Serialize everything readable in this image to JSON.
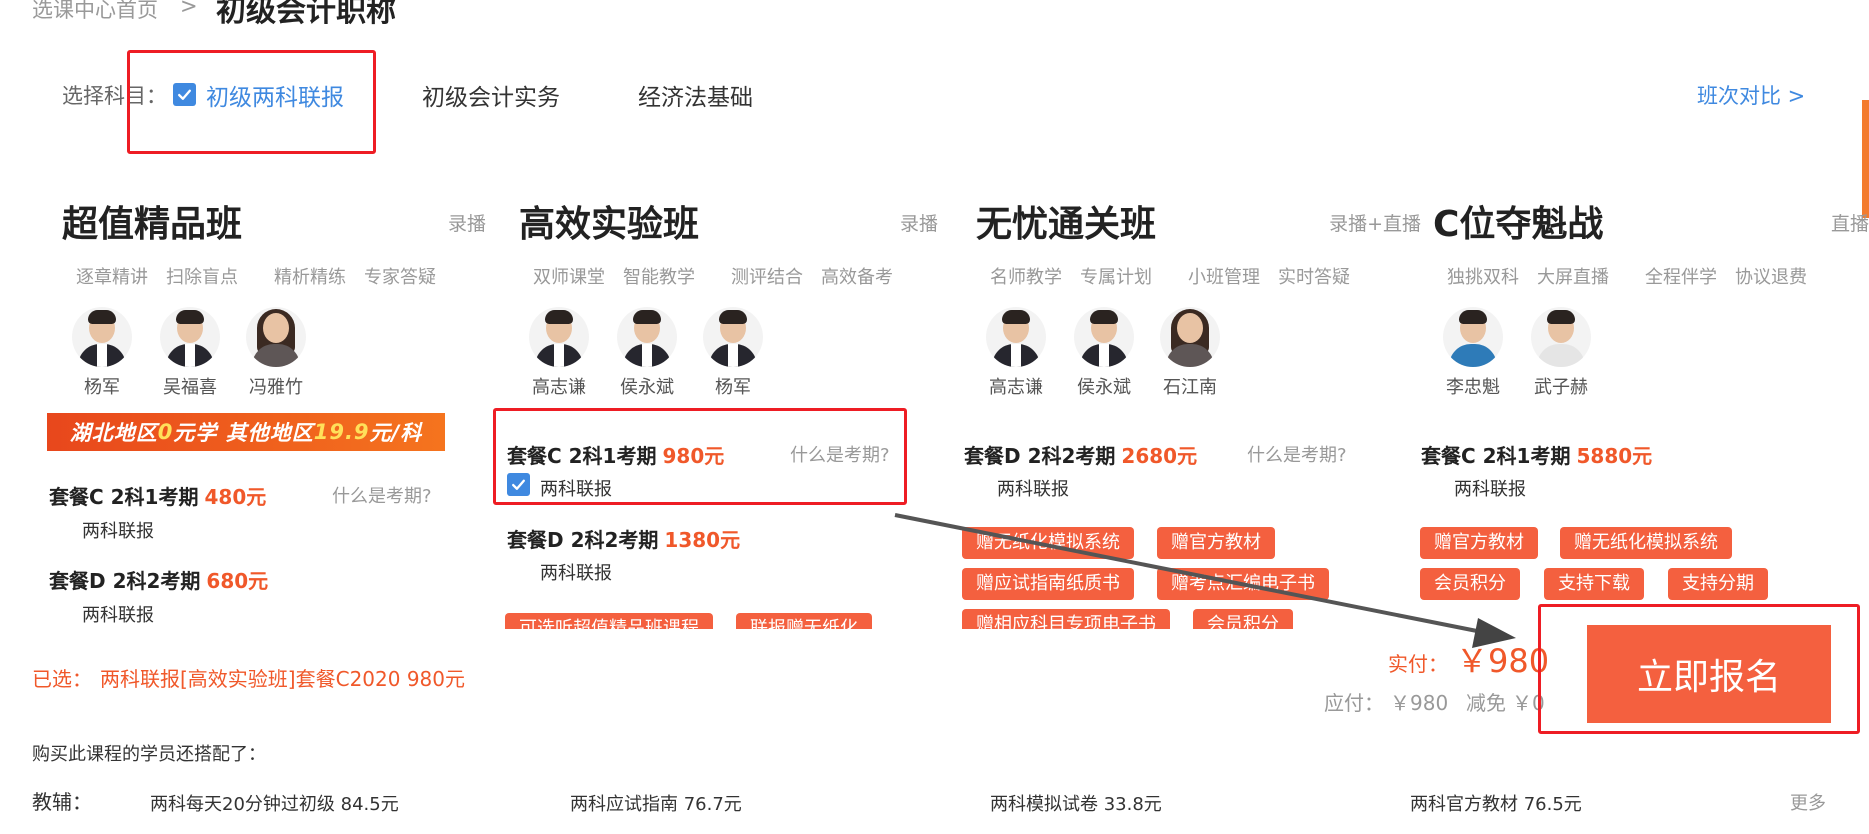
{
  "breadcrumb": {
    "home": "选课中心首页",
    "separator": ">",
    "current": "初级会计职称"
  },
  "subjects": {
    "label": "选择科目：",
    "items": [
      "初级两科联报",
      "初级会计实务",
      "经济法基础"
    ],
    "compare": "班次对比 >"
  },
  "columns": [
    {
      "title": "超值精品班",
      "mode": "录播",
      "features": [
        "逐章精讲",
        "扫除盲点",
        "精析精练",
        "专家答疑"
      ],
      "teachers": [
        "杨军",
        "吴福喜",
        "冯雅竹"
      ],
      "banner": {
        "part1": "湖北地区",
        "hl1": "0",
        "part2": "元学  其他地区",
        "hl2": "19.9",
        "part3": "元/科"
      },
      "packages": [
        {
          "name": "套餐C 2科1考期",
          "price": "480元",
          "question": "什么是考期?",
          "sub": "两科联报"
        },
        {
          "name": "套餐D 2科2考期",
          "price": "680元",
          "sub": "两科联报"
        }
      ]
    },
    {
      "title": "高效实验班",
      "mode": "录播",
      "features": [
        "双师课堂",
        "智能教学",
        "测评结合",
        "高效备考"
      ],
      "teachers": [
        "高志谦",
        "侯永斌",
        "杨军"
      ],
      "packages": [
        {
          "name": "套餐C 2科1考期",
          "price": "980元",
          "question": "什么是考期?",
          "sub": "两科联报"
        },
        {
          "name": "套餐D 2科2考期",
          "price": "1380元",
          "sub": "两科联报"
        }
      ],
      "tags": [
        "可选听超值精品班课程",
        "联报赠无纸化"
      ]
    },
    {
      "title": "无忧通关班",
      "mode": "录播+直播",
      "features": [
        "名师教学",
        "专属计划",
        "小班管理",
        "实时答疑"
      ],
      "teachers": [
        "高志谦",
        "侯永斌",
        "石江南"
      ],
      "packages": [
        {
          "name": "套餐D 2科2考期",
          "price": "2680元",
          "question": "什么是考期?",
          "sub": "两科联报"
        }
      ],
      "tags": [
        "赠无纸化模拟系统",
        "赠官方教材",
        "赠应试指南纸质书",
        "赠考点汇编电子书",
        "赠相应科目专项电子书",
        "会员积分"
      ]
    },
    {
      "title": "C位夺魁战",
      "mode": "直播",
      "features": [
        "独挑双科",
        "大屏直播",
        "全程伴学",
        "协议退费"
      ],
      "teachers": [
        "李忠魁",
        "武子赫"
      ],
      "packages": [
        {
          "name": "套餐C 2科1考期",
          "price": "5880元",
          "sub": "两科联报"
        }
      ],
      "tags": [
        "赠官方教材",
        "赠无纸化模拟系统",
        "会员积分",
        "支持下载",
        "支持分期"
      ]
    }
  ],
  "summary": {
    "chosen_label": "已选：",
    "chosen_value": "两科联报[高效实验班]套餐C2020    980元",
    "actual_label": "实付：",
    "actual_value": "￥980",
    "due_label": "应付：",
    "due_value": "￥980",
    "rebate_label": "减免",
    "rebate_value": "￥0",
    "enroll": "立即报名"
  },
  "recommend": {
    "title": "购买此课程的学员还搭配了：",
    "aux_label": "教辅：",
    "items": [
      "两科每天20分钟过初级 84.5元",
      "两科应试指南 76.7元",
      "两科模拟试卷 33.8元",
      "两科官方教材 76.5元"
    ],
    "more": "更多"
  },
  "colors": {
    "accent": "#f4603f",
    "price": "#f0582a",
    "link": "#3f89e0",
    "highlight_box": "#ee1d24"
  }
}
